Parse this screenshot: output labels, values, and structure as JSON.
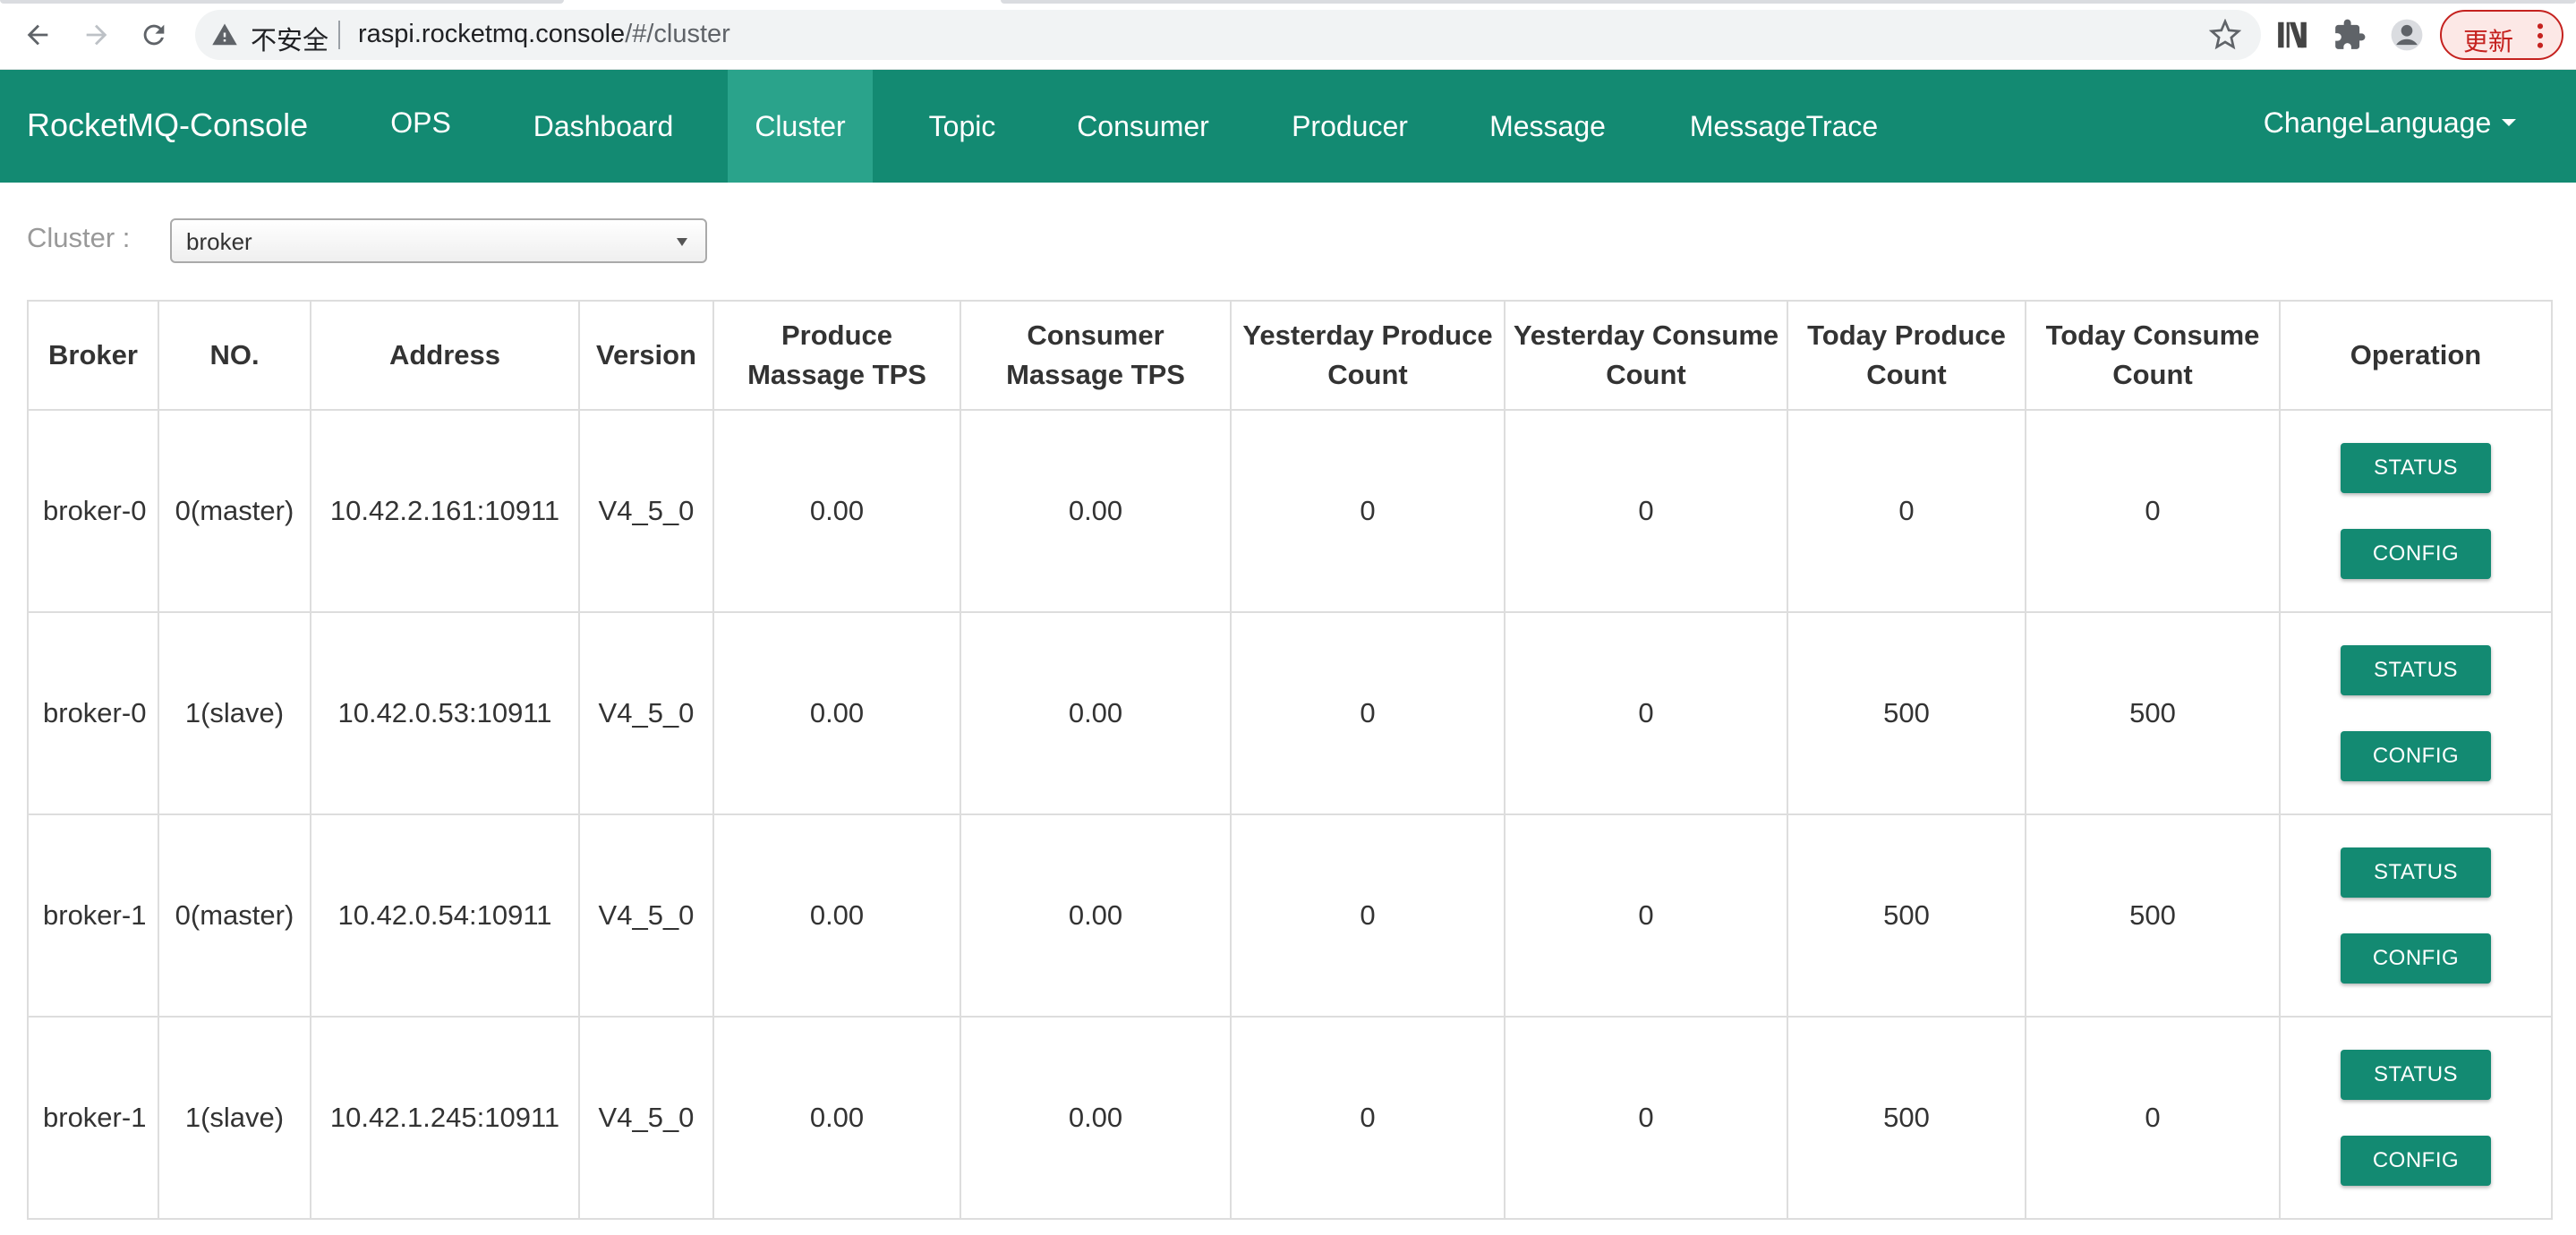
{
  "browser": {
    "insecure_label": "不安全",
    "url_host": "raspi.rocketmq.console",
    "url_path": "/#/cluster",
    "update_label": "更新"
  },
  "navbar": {
    "brand": "RocketMQ-Console",
    "items": [
      {
        "label": "OPS",
        "active": false
      },
      {
        "label": "Dashboard",
        "active": false
      },
      {
        "label": "Cluster",
        "active": true
      },
      {
        "label": "Topic",
        "active": false
      },
      {
        "label": "Consumer",
        "active": false
      },
      {
        "label": "Producer",
        "active": false
      },
      {
        "label": "Message",
        "active": false
      },
      {
        "label": "MessageTrace",
        "active": false
      }
    ],
    "change_language": "ChangeLanguage"
  },
  "cluster": {
    "label": "Cluster :",
    "selected": "broker"
  },
  "table": {
    "headers": [
      "Broker",
      "NO.",
      "Address",
      "Version",
      "Produce Massage TPS",
      "Consumer Massage TPS",
      "Yesterday Produce Count",
      "Yesterday Consume Count",
      "Today Produce Count",
      "Today Consume Count",
      "Operation"
    ],
    "rows": [
      {
        "broker": "broker-0",
        "no": "0(master)",
        "address": "10.42.2.161:10911",
        "version": "V4_5_0",
        "produce_tps": "0.00",
        "consume_tps": "0.00",
        "yesterday_produce": "0",
        "yesterday_consume": "0",
        "today_produce": "0",
        "today_consume": "0"
      },
      {
        "broker": "broker-0",
        "no": "1(slave)",
        "address": "10.42.0.53:10911",
        "version": "V4_5_0",
        "produce_tps": "0.00",
        "consume_tps": "0.00",
        "yesterday_produce": "0",
        "yesterday_consume": "0",
        "today_produce": "500",
        "today_consume": "500"
      },
      {
        "broker": "broker-1",
        "no": "0(master)",
        "address": "10.42.0.54:10911",
        "version": "V4_5_0",
        "produce_tps": "0.00",
        "consume_tps": "0.00",
        "yesterday_produce": "0",
        "yesterday_consume": "0",
        "today_produce": "500",
        "today_consume": "500"
      },
      {
        "broker": "broker-1",
        "no": "1(slave)",
        "address": "10.42.1.245:10911",
        "version": "V4_5_0",
        "produce_tps": "0.00",
        "consume_tps": "0.00",
        "yesterday_produce": "0",
        "yesterday_consume": "0",
        "today_produce": "500",
        "today_consume": "0"
      }
    ],
    "status_label": "STATUS",
    "config_label": "CONFIG"
  },
  "colors": {
    "brand": "#138a72",
    "nav_active": "#2aa38b"
  }
}
